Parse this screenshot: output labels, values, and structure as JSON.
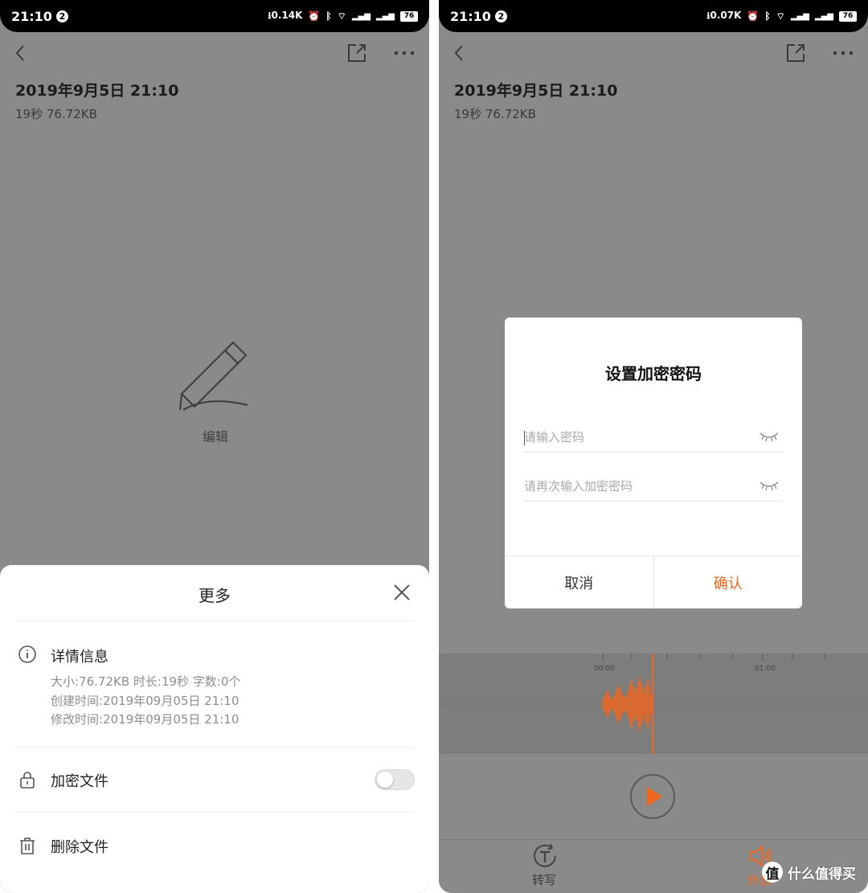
{
  "status_bar_left": {
    "time": "21:10",
    "badge": "2",
    "speed": "0.14K",
    "battery": "76"
  },
  "status_bar_right": {
    "time": "21:10",
    "badge": "2",
    "speed": "0.07K",
    "battery": "76"
  },
  "recording": {
    "title": "2019年9月5日 21:10",
    "meta": "19秒 76.72KB"
  },
  "edit": {
    "label": "编辑"
  },
  "sheet": {
    "title": "更多",
    "details": {
      "title": "详情信息",
      "lines": [
        "大小:76.72KB  时长:19秒  字数:0个",
        "创建时间:2019年09月05日 21:10",
        "修改时间:2019年09月05日 21:10"
      ]
    },
    "encrypt": {
      "label": "加密文件",
      "enabled": false
    },
    "delete": {
      "label": "删除文件"
    }
  },
  "dialog": {
    "title": "设置加密密码",
    "password_placeholder": "请输入密码",
    "confirm_placeholder": "请再次输入加密密码",
    "cancel_label": "取消",
    "confirm_label": "确认"
  },
  "timeline": {
    "start": "00:00",
    "mark": "01:00"
  },
  "bottom_bar": {
    "transcribe_label": "转写",
    "speaker_label": "外放"
  },
  "watermark": {
    "logo": "值",
    "text": "什么值得买"
  },
  "colors": {
    "accent": "#f0661d",
    "dim_background": "#8a8a8a"
  },
  "icons": [
    "back-icon",
    "share-icon",
    "more-icon",
    "pen-icon",
    "close-icon",
    "info-icon",
    "lock-icon",
    "trash-icon",
    "eye-closed-icon",
    "play-icon",
    "transcribe-icon",
    "speaker-icon"
  ]
}
